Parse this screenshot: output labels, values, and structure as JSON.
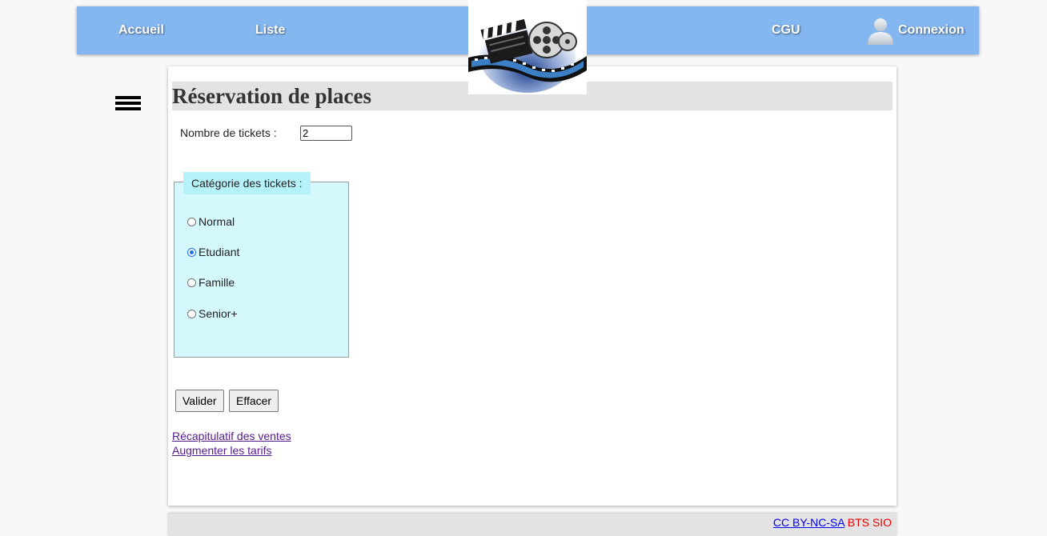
{
  "nav": {
    "home": "Accueil",
    "list": "Liste",
    "cgu": "CGU",
    "login": "Connexion"
  },
  "form": {
    "title": "Réservation de places",
    "tickets_label": "Nombre de tickets :",
    "tickets_value": "2",
    "category_legend": "Catégorie des tickets :",
    "options": [
      {
        "label": "Normal",
        "checked": false
      },
      {
        "label": "Etudiant",
        "checked": true
      },
      {
        "label": "Famille",
        "checked": false
      },
      {
        "label": "Senior+",
        "checked": false
      }
    ],
    "submit_label": "Valider",
    "reset_label": "Effacer"
  },
  "links": {
    "sales_summary": "Récapitulatif des ventes",
    "raise_prices": "Augmenter les tarifs"
  },
  "footer": {
    "license": "CC BY-NC-SA",
    "org": "BTS SIO"
  },
  "colors": {
    "navbar": "#84b6f0",
    "fieldset": "#d4f8fc",
    "legend": "#b6f2fa",
    "title_bar": "#e3e3e3",
    "footer_red": "#ee0000"
  }
}
